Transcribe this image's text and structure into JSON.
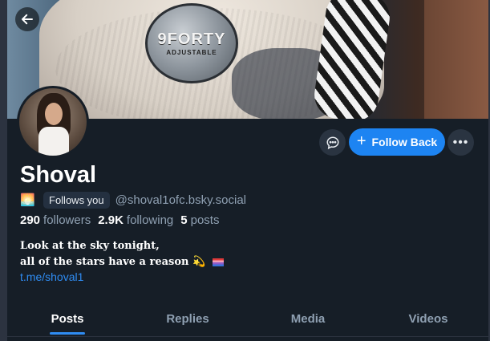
{
  "profile": {
    "display_name": "Shoval",
    "status_emoji": "🌅",
    "follows_you": "Follows you",
    "handle": "@shoval1ofc.bsky.social",
    "stats": {
      "followers_count": "290",
      "followers_label": "followers",
      "following_count": "2.9K",
      "following_label": "following",
      "posts_count": "5",
      "posts_label": "posts"
    },
    "bio_line1": "Look at the sky tonight,",
    "bio_line2": "all of the stars have a reason",
    "bio_emoji": "💫",
    "link": "t.me/shoval1"
  },
  "banner": {
    "patch_text": "9FORTY",
    "patch_subtext": "ADJUSTABLE"
  },
  "actions": {
    "follow_back_label": "Follow Back",
    "follow_icon": "+",
    "more_label": "•••"
  },
  "tabs": [
    {
      "label": "Posts",
      "active": true
    },
    {
      "label": "Replies",
      "active": false
    },
    {
      "label": "Media",
      "active": false
    },
    {
      "label": "Videos",
      "active": false
    }
  ],
  "colors": {
    "background": "#161e27",
    "accent": "#1d84f2",
    "muted_text": "#8fa0b2",
    "link": "#2f8cf2"
  }
}
